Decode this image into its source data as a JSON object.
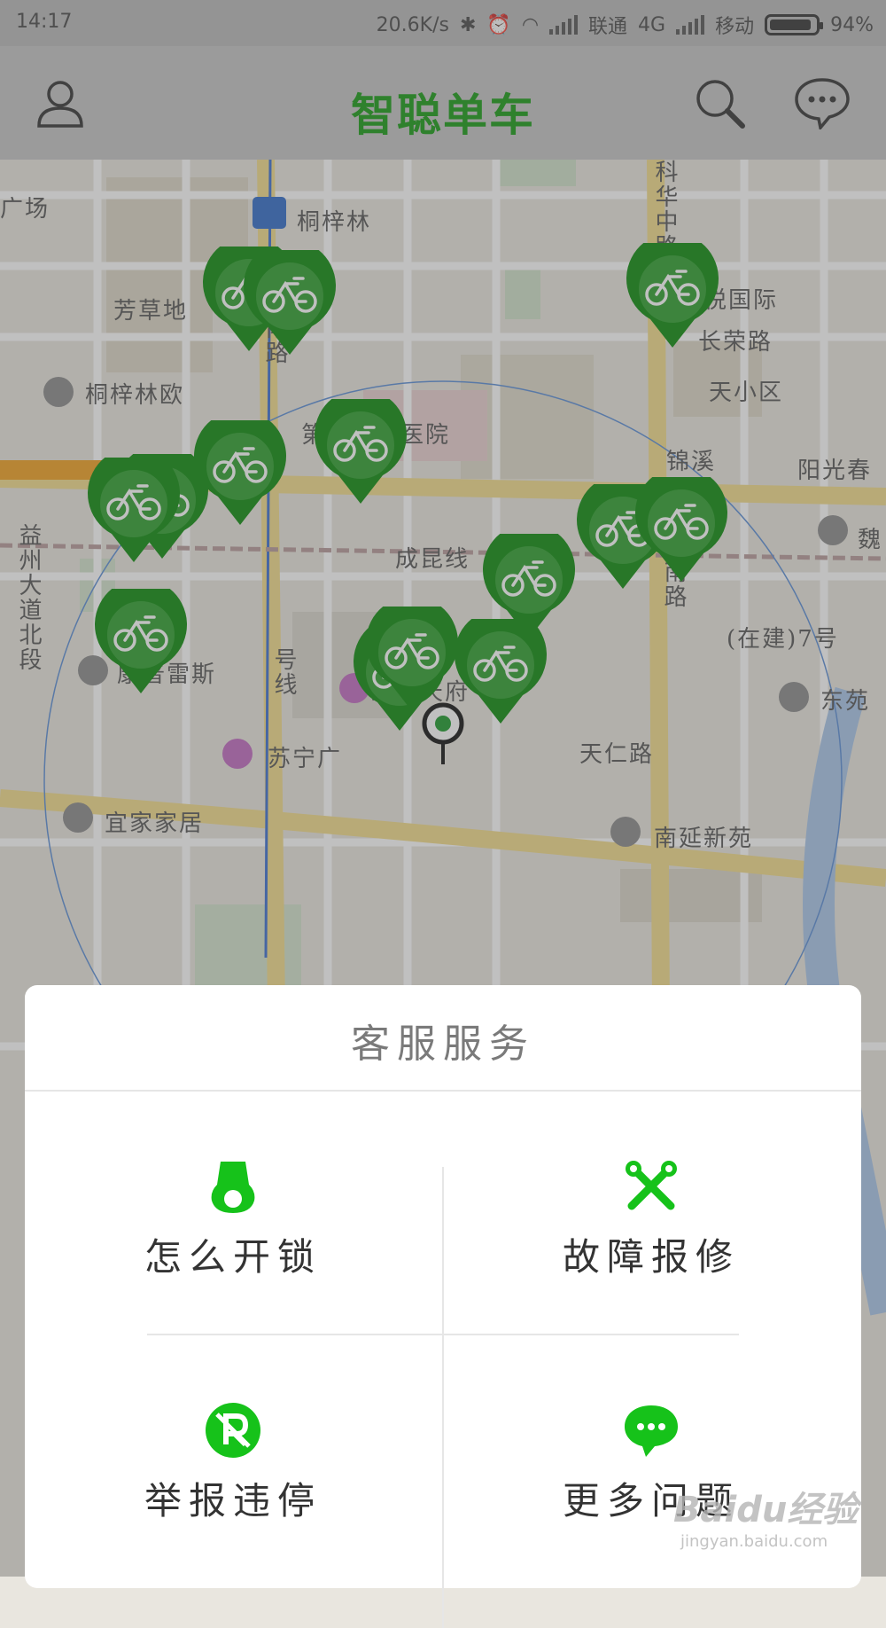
{
  "status_bar": {
    "time": "14:17",
    "speed": "20.6K/s",
    "carrier1": "联通",
    "network": "4G",
    "carrier2": "移动",
    "battery": "94%"
  },
  "app_bar": {
    "title": "智聪单车",
    "accent_color": "#159a12"
  },
  "map": {
    "labels": [
      {
        "text": "广场"
      },
      {
        "text": "桐梓林"
      },
      {
        "text": "芳草地"
      },
      {
        "text": "科华中路"
      },
      {
        "text": "人民南路"
      },
      {
        "text": "泛悦国际"
      },
      {
        "text": "长荣路"
      },
      {
        "text": "桐梓林欧"
      },
      {
        "text": "第二人民医院"
      },
      {
        "text": "天小区"
      },
      {
        "text": "锦溪"
      },
      {
        "text": "阳光春"
      },
      {
        "text": "益州大道北段"
      },
      {
        "text": "科华南路"
      },
      {
        "text": "魏"
      },
      {
        "text": "成昆线"
      },
      {
        "text": "康普雷斯"
      },
      {
        "text": "凯德天府"
      },
      {
        "text": "东苑"
      },
      {
        "text": "苏宁广"
      },
      {
        "text": "天仁路"
      },
      {
        "text": "宜家家居"
      },
      {
        "text": "南延新苑"
      },
      {
        "text": "(在建)7号"
      },
      {
        "text": "号线"
      }
    ],
    "bike_marker_icon": "bike-marker-icon",
    "location_icon": "current-location-icon"
  },
  "dialog": {
    "title": "客服服务",
    "options": [
      {
        "label": "怎么开锁",
        "icon": "unlock-icon"
      },
      {
        "label": "故障报修",
        "icon": "repair-tools-icon"
      },
      {
        "label": "举报违停",
        "icon": "illegal-parking-icon"
      },
      {
        "label": "更多问题",
        "icon": "chat-bubble-icon"
      }
    ]
  },
  "watermark": {
    "text": "Baidu经验",
    "url_text": "jingyan.baidu.com"
  }
}
